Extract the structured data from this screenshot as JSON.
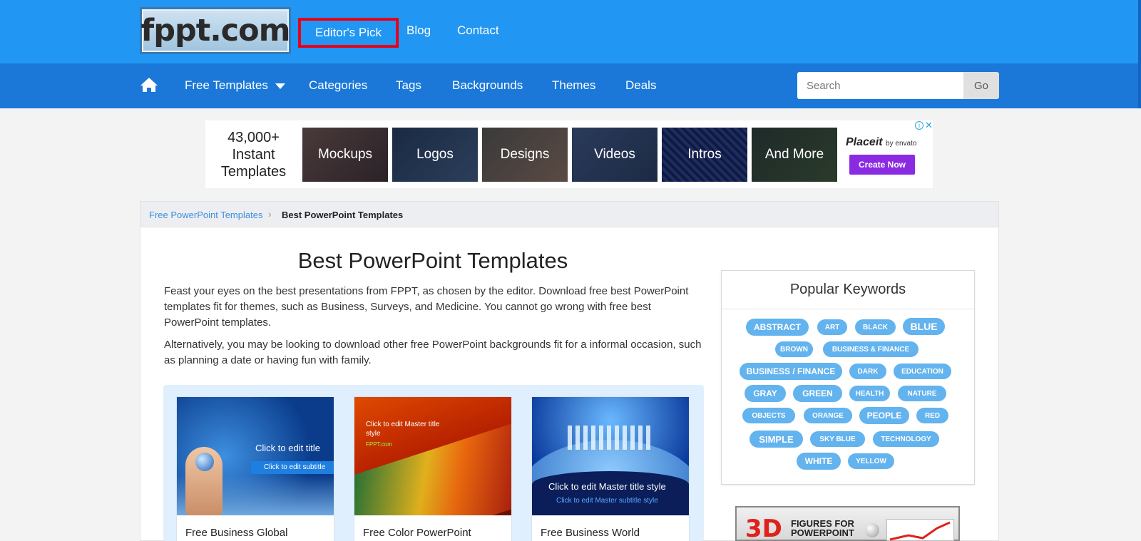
{
  "header": {
    "logo_text": "fppt.com",
    "links": [
      "Editor's Pick",
      "Blog",
      "Contact"
    ]
  },
  "nav": {
    "items": [
      "Free Templates",
      "Categories",
      "Tags",
      "Backgrounds",
      "Themes",
      "Deals"
    ],
    "search_placeholder": "Search",
    "go_label": "Go"
  },
  "ad": {
    "headline": [
      "43,000+",
      "Instant",
      "Templates"
    ],
    "tiles": [
      "Mockups",
      "Logos",
      "Designs",
      "Videos",
      "Intros",
      "And More"
    ],
    "brand": "Placeit",
    "brand_sub": "by envato",
    "cta": "Create Now",
    "close": "✕",
    "info": "i"
  },
  "breadcrumb": {
    "parent": "Free PowerPoint Templates",
    "separator": "›",
    "current": "Best PowerPoint Templates"
  },
  "main": {
    "title": "Best PowerPoint Templates",
    "paragraphs": [
      "Feast your eyes on the best presentations from FPPT, as chosen by the editor. Download free best PowerPoint templates fit for themes, such as Business, Surveys, and Medicine. You cannot go wrong with free best PowerPoint templates.",
      "Alternatively, you may be looking to download other free PowerPoint backgrounds fit for a informal occasion, such as planning a date or having fun with family."
    ],
    "templates": [
      {
        "name": "Free Business Global",
        "thumb_title": "Click to edit title",
        "thumb_sub": "Click to edit subtitle"
      },
      {
        "name": "Free Color PowerPoint",
        "thumb_title": "Click to edit Master title style",
        "thumb_sub": "FPPT.com"
      },
      {
        "name": "Free Business World",
        "thumb_title": "Click to edit Master title style",
        "thumb_sub": "Click to edit Master subtitle style"
      }
    ]
  },
  "sidebar": {
    "keywords_title": "Popular Keywords",
    "keywords": [
      "ABSTRACT",
      "ART",
      "BLACK",
      "BLUE",
      "BROWN",
      "BUSINESS & FINANCE",
      "BUSINESS / FINANCE",
      "DARK",
      "EDUCATION",
      "GRAY",
      "GREEN",
      "HEALTH",
      "NATURE",
      "OBJECTS",
      "ORANGE",
      "PEOPLE",
      "RED",
      "SIMPLE",
      "SKY BLUE",
      "TECHNOLOGY",
      "WHITE",
      "YELLOW"
    ],
    "promo_big": "3D",
    "promo_text": [
      "FIGURES FOR",
      "POWERPOINT"
    ]
  },
  "colors": {
    "header_blue": "#2196f3",
    "nav_blue": "#1b78d8",
    "highlight_red": "#e6001a",
    "tag_blue": "#63b3ee",
    "cta_purple": "#8a2be2"
  }
}
